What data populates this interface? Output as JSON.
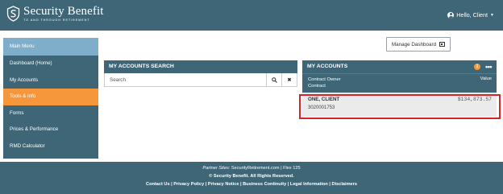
{
  "header": {
    "brand_name": "Security Benefit",
    "brand_tagline": "TO AND THROUGH RETIREMENT",
    "greeting": "Hello, Client",
    "user_icon": "user-circle-icon",
    "caret_icon": "caret-down-icon"
  },
  "sidebar": {
    "items": [
      {
        "label": "Main Menu"
      },
      {
        "label": "Dashboard (Home)"
      },
      {
        "label": "My Accounts"
      },
      {
        "label": "Tools & Info"
      },
      {
        "label": "Forms"
      },
      {
        "label": "Prices & Performance"
      },
      {
        "label": "RMD Calculator"
      }
    ]
  },
  "toolbar": {
    "manage_label": "Manage Dashboard",
    "manage_icon": "dashboard-layout-icon"
  },
  "search_panel": {
    "title": "MY ACCOUNTS SEARCH",
    "placeholder": "Search",
    "search_icon": "search-icon",
    "clear_label": "✖"
  },
  "accounts_panel": {
    "title": "MY ACCOUNTS",
    "badge_count": "1",
    "more_label": "•••",
    "col_owner_line1": "Contract Owner",
    "col_owner_line2": "Contract",
    "col_value": "Value",
    "rows": [
      {
        "name": "ONE, CLIENT",
        "contract": "3020001753",
        "value": "$134,873.57"
      }
    ]
  },
  "footer": {
    "partner_label": "Partner Sites:",
    "partner_site": "SecurityRetirement.com",
    "flex": "Flex 125",
    "copyright": "© Security Benefit. All Rights Reserved.",
    "links": [
      "Contact Us",
      "Privacy Policy",
      "Privacy Notice",
      "Business Continuity",
      "Legal Information",
      "Disclaimers"
    ]
  },
  "colors": {
    "primary": "#3f6677",
    "main_menu": "#7faecb",
    "accent": "#f6973c",
    "highlight": "#d8232a"
  }
}
